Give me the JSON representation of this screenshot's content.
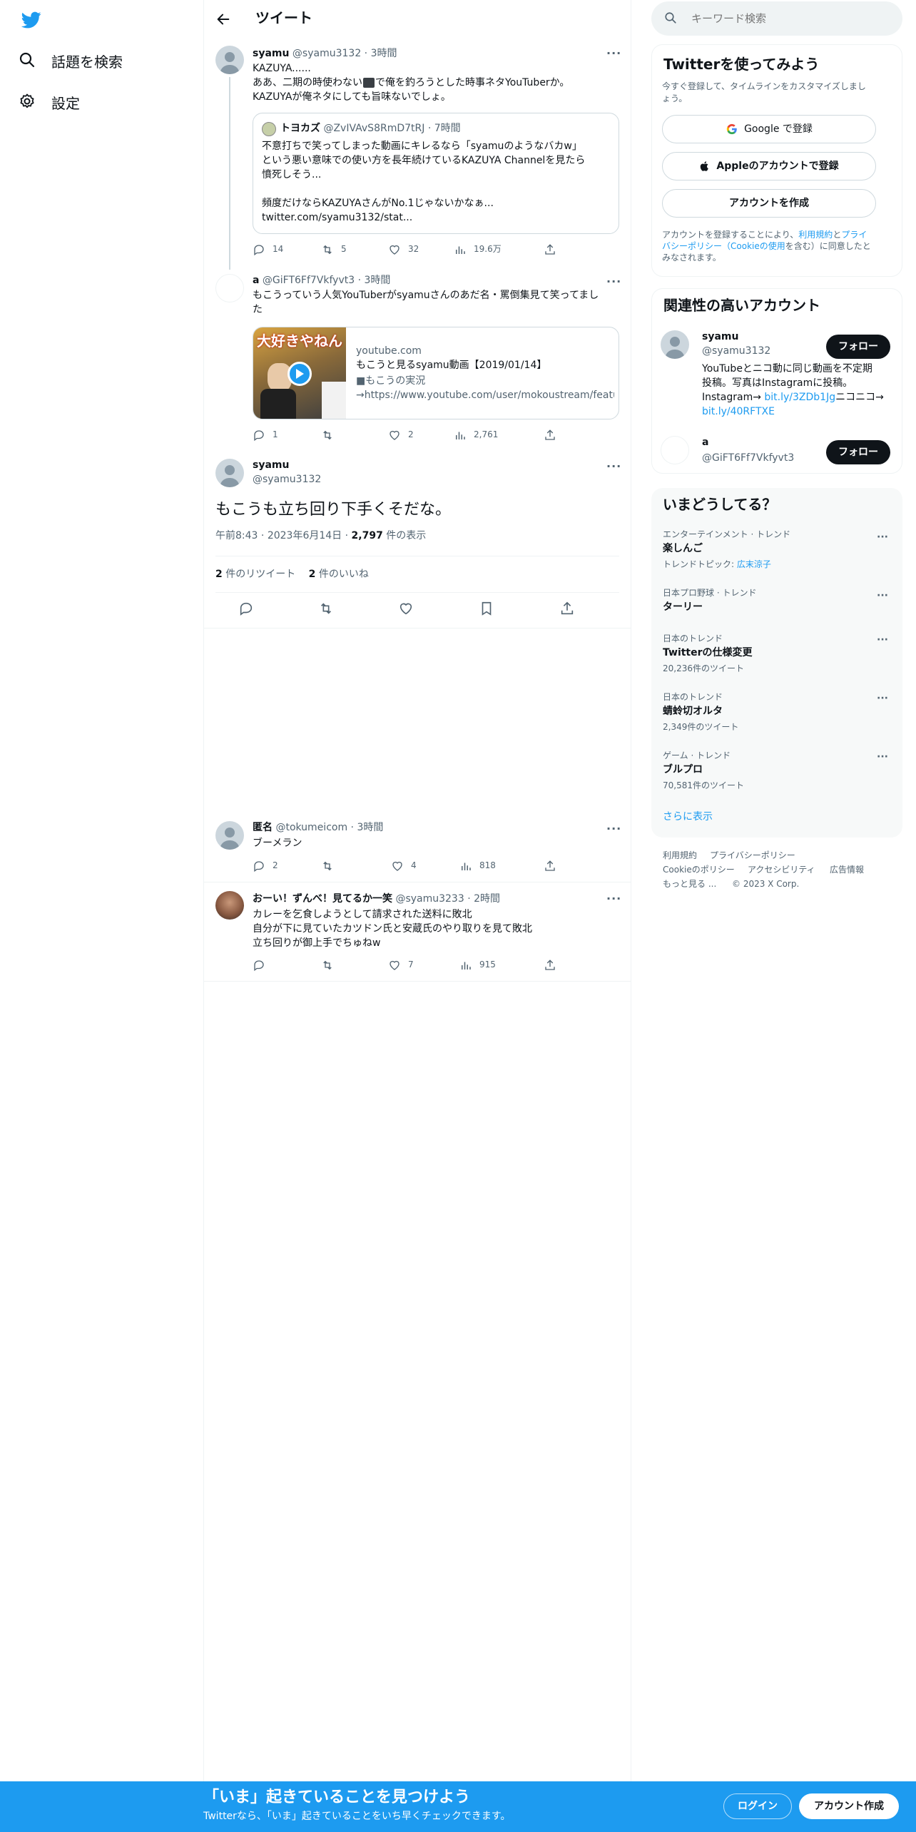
{
  "nav": {
    "explore_label": "話題を検索",
    "settings_label": "設定"
  },
  "header": {
    "title": "ツイート"
  },
  "parent_tweet": {
    "name": "syamu",
    "handle": "@syamu3132",
    "time": "3時間",
    "line1": "KAZUYA......",
    "line2_pre": "ああ、二期の時使わない",
    "line2_post": "で俺を釣ろうとした時事ネタYouTuberか。",
    "line3": "KAZUYAが俺ネタにしても旨味ないでしょ。",
    "quote": {
      "name": "トヨカズ",
      "handle": "@ZvIVAvS8RmD7tRJ",
      "time": "7時間",
      "line1": "不意打ちで笑ってしまった動画にキレるなら「syamuのようなバカw」",
      "line2": "という悪い意味での使い方を長年続けているKAZUYA Channelを見たら",
      "line3": "憤死しそう...",
      "line4": "頻度だけならKAZUYAさんがNo.1じゃないかなぁ...",
      "line5": "twitter.com/syamu3132/stat..."
    },
    "replies": "14",
    "retweets": "5",
    "likes": "32",
    "views": "19.6万"
  },
  "reply_tweet_a": {
    "name": "a",
    "handle": "@GiFT6Ff7Vkfyvt3",
    "time": "3時間",
    "line1": "もこうっていう人気YouTuberがsyamuさんのあだ名・罵倒集見て笑ってまし",
    "line2": "た",
    "card": {
      "domain": "youtube.com",
      "title": "もこうと見るsyamu動画【2019/01/14】",
      "desc1": "■もこうの実況",
      "desc2": "→https://www.youtube.com/user/mokoustream/featu...",
      "thumb_text": "大好きやねん"
    },
    "replies": "1",
    "likes": "2",
    "views": "2,761"
  },
  "main_tweet": {
    "name": "syamu",
    "handle": "@syamu3132",
    "text": "もこうも立ち回り下手くそだな。",
    "time": "午前8:43",
    "date": "2023年6月14日",
    "views_count": "2,797",
    "views_label": "件の表示",
    "retweet_count": "2",
    "retweet_label": "件のリツイート",
    "like_count": "2",
    "like_label": "件のいいね"
  },
  "replies": [
    {
      "name": "匿名",
      "handle": "@tokumeicom",
      "time": "3時間",
      "text": "ブーメラン",
      "replies": "2",
      "likes": "4",
      "views": "818"
    },
    {
      "name": "おーい！ずんべ！見てるか一笑",
      "handle": "@syamu3233",
      "time": "2時間",
      "line1": "カレーを乞食しようとして請求された送料に敗北",
      "line2": "自分が下に見ていたカツドン氏と安蔵氏のやり取りを見て敗北",
      "line3": "立ち回りが御上手でちゅねw",
      "likes": "7",
      "views": "915"
    }
  ],
  "search": {
    "placeholder": "キーワード検索"
  },
  "signup": {
    "title": "Twitterを使ってみよう",
    "subtitle1": "今すぐ登録して、タイムラインをカスタマイズしまし",
    "subtitle2": "ょう。",
    "google_label": "Google で登録",
    "apple_label": "Appleのアカウントで登録",
    "create_label": "アカウントを作成",
    "terms_pre": "アカウントを登録することにより、",
    "terms_link1": "利用規約",
    "terms_and": "と",
    "terms_link2": "プライ",
    "terms_link3": "バシーポリシー（Cookieの使用",
    "terms_post1": "を含む）に同意したと",
    "terms_post2": "みなされます。"
  },
  "related": {
    "title": "関連性の高いアカウント",
    "follow_label": "フォロー",
    "accounts": [
      {
        "name": "syamu",
        "handle": "@syamu3132",
        "bio1": "YouTubeとニコ動に同じ動画を不定期",
        "bio2": "投稿。写真はInstagramに投稿。",
        "bio3_pre": "Instagram→ ",
        "bio3_link": "bit.ly/3ZDb1Jg",
        "bio3_post": "ニコニコ→",
        "bio4_link": "bit.ly/40RFTXE"
      },
      {
        "name": "a",
        "handle": "@GiFT6Ff7Vkfyvt3"
      }
    ]
  },
  "trends": {
    "title": "いまどうしてる？",
    "items": [
      {
        "category": "エンターテインメント · トレンド",
        "name": "楽しんご",
        "topic_label": "トレンドトピック: ",
        "topic": "広末涼子"
      },
      {
        "category": "日本プロ野球 · トレンド",
        "name": "ターリー"
      },
      {
        "category": "日本のトレンド",
        "name": "Twitterの仕様変更",
        "count": "20,236件のツイート"
      },
      {
        "category": "日本のトレンド",
        "name": "蜻蛉切オルタ",
        "count": "2,349件のツイート"
      },
      {
        "category": "ゲーム · トレンド",
        "name": "ブルプロ",
        "count": "70,581件のツイート"
      }
    ],
    "show_more": "さらに表示"
  },
  "footer": {
    "links": [
      "利用規約",
      "プライバシーポリシー",
      "Cookieのポリシー",
      "アクセシビリティ",
      "広告情報",
      "もっと見る ...",
      "© 2023 X Corp."
    ]
  },
  "bottom_bar": {
    "headline": "「いま」起きていることを見つけよう",
    "sub": "Twitterなら、「いま」起きていることをいち早くチェックできます。",
    "login_label": "ログイン",
    "signup_label": "アカウント作成"
  },
  "colors": {
    "accent": "#1d9bf0",
    "text": "#0f1419",
    "muted": "#536471",
    "border": "#eff3f4"
  }
}
